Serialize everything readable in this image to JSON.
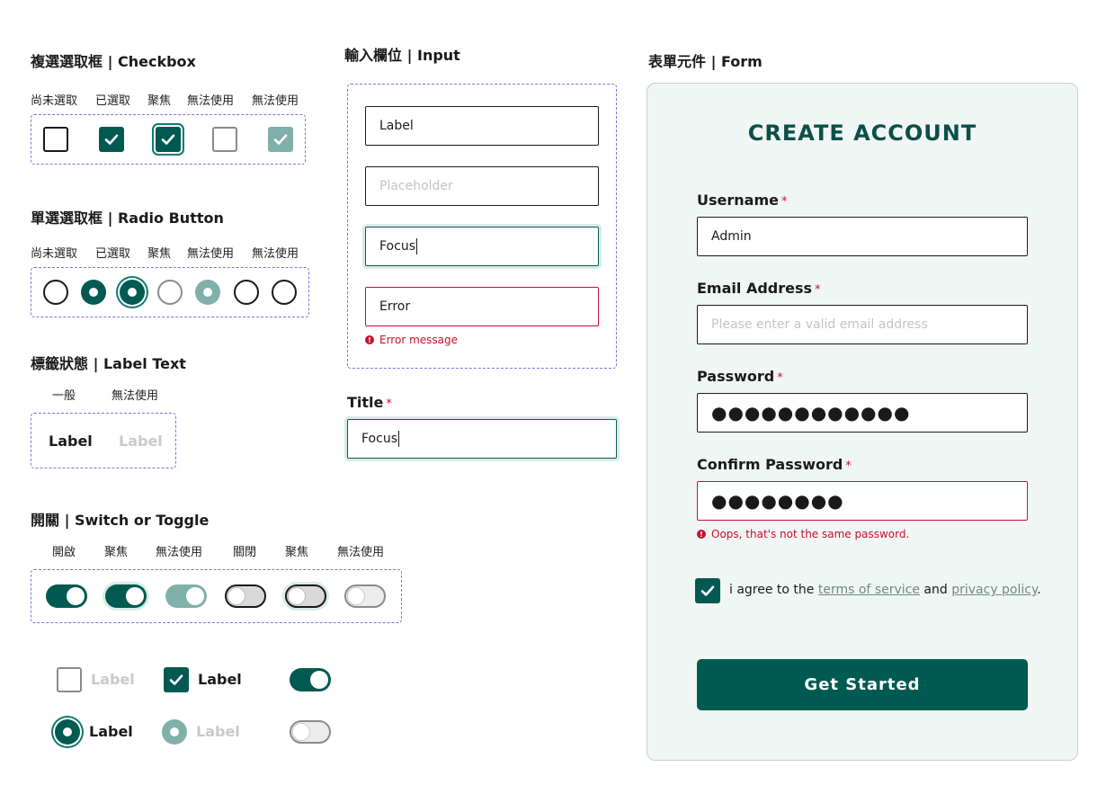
{
  "checkbox": {
    "title": "複選選取框 | Checkbox",
    "states": [
      "尚未選取",
      "已選取",
      "聚焦",
      "無法使用",
      "無法使用"
    ]
  },
  "radio": {
    "title": "單選選取框 | Radio Button",
    "states": [
      "尚未選取",
      "已選取",
      "聚焦",
      "無法使用",
      "無法使用"
    ]
  },
  "label_text": {
    "title": "標籤狀態 | Label Text",
    "states": [
      "一般",
      "無法使用"
    ],
    "normal": "Label",
    "disabled": "Label"
  },
  "toggle": {
    "title": "開關 | Switch or Toggle",
    "states": [
      "開啟",
      "聚焦",
      "無法使用",
      "關閉",
      "聚焦",
      "無法使用"
    ]
  },
  "combos": {
    "checkbox_off_label": "Label",
    "checkbox_on_label": "Label",
    "radio_on_label": "Label",
    "radio_dis_label": "Label"
  },
  "input": {
    "title": "輸入欄位 | Input",
    "label_value": "Label",
    "placeholder": "Placeholder",
    "focus_value": "Focus",
    "error_value": "Error",
    "error_message": "Error message",
    "titled_label": "Title",
    "titled_required": "*",
    "titled_value": "Focus"
  },
  "form": {
    "section_title": "表單元件 | Form",
    "heading": "CREATE ACCOUNT",
    "username_label": "Username",
    "username_value": "Admin",
    "email_label": "Email Address",
    "email_placeholder": "Please enter a valid email address",
    "password_label": "Password",
    "password_value": "●●●●●●●●●●●●",
    "confirm_label": "Confirm Password",
    "confirm_value": "●●●●●●●●",
    "confirm_error": "Oops, that's not the same password.",
    "required_mark": "*",
    "agree_prefix": "i agree to the",
    "terms_link": "terms of service",
    "agree_and": "and",
    "privacy_link": "privacy policy",
    "agree_suffix": ".",
    "submit_label": "Get Started"
  },
  "colors": {
    "primary": "#005a52",
    "disabled": "#7fb0aa",
    "error": "#c8102e",
    "dashed_outline": "#8b6fd6",
    "card_bg": "#f0f6f4"
  }
}
